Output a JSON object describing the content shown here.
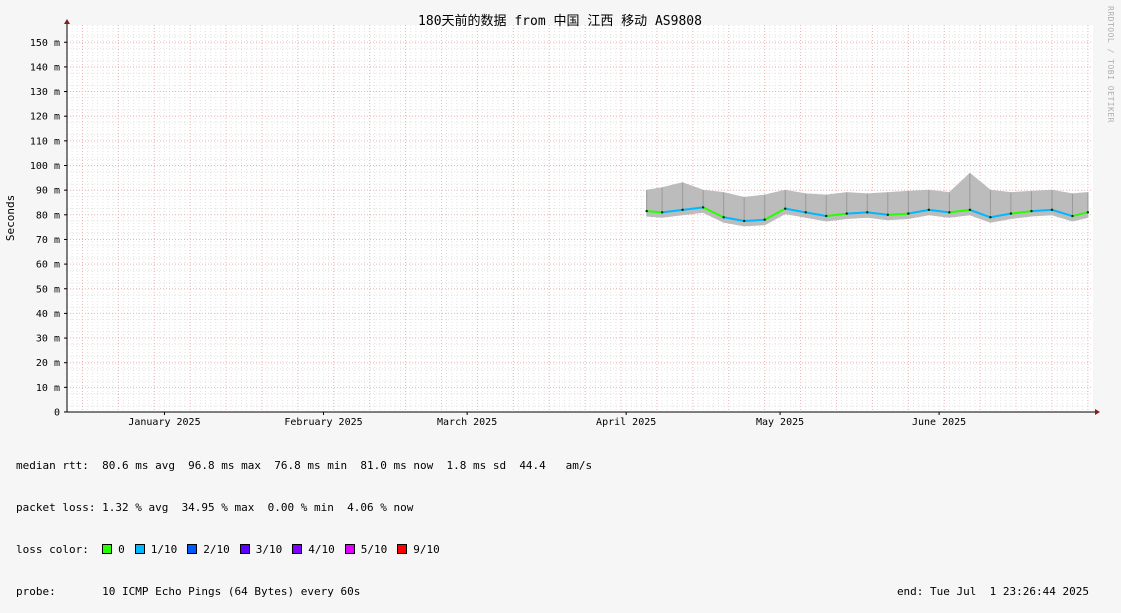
{
  "chart_data": {
    "type": "area",
    "title": "180天前的数据 from 中国 江西 移动 AS9808",
    "ylabel": "Seconds",
    "ylim": [
      0,
      157
    ],
    "y_ticks": [
      {
        "value": 0,
        "label": "0"
      },
      {
        "value": 10,
        "label": "10 m"
      },
      {
        "value": 20,
        "label": "20 m"
      },
      {
        "value": 30,
        "label": "30 m"
      },
      {
        "value": 40,
        "label": "40 m"
      },
      {
        "value": 50,
        "label": "50 m"
      },
      {
        "value": 60,
        "label": "60 m"
      },
      {
        "value": 70,
        "label": "70 m"
      },
      {
        "value": 80,
        "label": "80 m"
      },
      {
        "value": 90,
        "label": "90 m"
      },
      {
        "value": 100,
        "label": "100 m"
      },
      {
        "value": 110,
        "label": "110 m"
      },
      {
        "value": 120,
        "label": "120 m"
      },
      {
        "value": 130,
        "label": "130 m"
      },
      {
        "value": 140,
        "label": "140 m"
      },
      {
        "value": 150,
        "label": "150 m"
      }
    ],
    "xlim": [
      "2024-12-13",
      "2025-07-01"
    ],
    "x_ticks": [
      {
        "date": "2025-01-01",
        "label": "January 2025"
      },
      {
        "date": "2025-02-01",
        "label": "February 2025"
      },
      {
        "date": "2025-03-01",
        "label": "March 2025"
      },
      {
        "date": "2025-04-01",
        "label": "April 2025"
      },
      {
        "date": "2025-05-01",
        "label": "May 2025"
      },
      {
        "date": "2025-06-01",
        "label": "June 2025"
      }
    ],
    "grid": true,
    "series": [
      {
        "name": "median rtt",
        "x": [
          "2025-04-05",
          "2025-04-08",
          "2025-04-12",
          "2025-04-16",
          "2025-04-20",
          "2025-04-24",
          "2025-04-28",
          "2025-05-02",
          "2025-05-06",
          "2025-05-10",
          "2025-05-14",
          "2025-05-18",
          "2025-05-22",
          "2025-05-26",
          "2025-05-30",
          "2025-06-03",
          "2025-06-07",
          "2025-06-11",
          "2025-06-15",
          "2025-06-19",
          "2025-06-23",
          "2025-06-27",
          "2025-06-30"
        ],
        "values": [
          81.5,
          81.0,
          82.0,
          83.0,
          79.0,
          77.5,
          78.0,
          82.5,
          81.0,
          79.5,
          80.5,
          81.0,
          80.0,
          80.5,
          82.0,
          81.0,
          82.0,
          79.0,
          80.5,
          81.5,
          82.0,
          79.5,
          81.0
        ]
      },
      {
        "name": "max rtt",
        "x": [
          "2025-04-05",
          "2025-04-08",
          "2025-04-12",
          "2025-04-16",
          "2025-04-20",
          "2025-04-24",
          "2025-04-28",
          "2025-05-02",
          "2025-05-06",
          "2025-05-10",
          "2025-05-14",
          "2025-05-18",
          "2025-05-22",
          "2025-05-26",
          "2025-05-30",
          "2025-06-03",
          "2025-06-07",
          "2025-06-11",
          "2025-06-15",
          "2025-06-19",
          "2025-06-23",
          "2025-06-27",
          "2025-06-30"
        ],
        "values": [
          90.0,
          91.0,
          93.0,
          90.0,
          89.0,
          87.0,
          88.0,
          90.0,
          88.5,
          88.0,
          89.0,
          88.5,
          89.0,
          89.5,
          90.0,
          89.0,
          96.8,
          90.0,
          89.0,
          89.5,
          90.0,
          88.5,
          89.0
        ]
      }
    ],
    "loss_colors": [
      {
        "label": "0",
        "color": "#26ff00"
      },
      {
        "label": "1/10",
        "color": "#00b8ff"
      },
      {
        "label": "2/10",
        "color": "#0059ff"
      },
      {
        "label": "3/10",
        "color": "#5e00ff"
      },
      {
        "label": "4/10",
        "color": "#7e00ff"
      },
      {
        "label": "5/10",
        "color": "#dd00ff"
      },
      {
        "label": "9/10",
        "color": "#ff0000"
      }
    ],
    "watermark": "RRDTOOL / TOBI OETIKER"
  },
  "stats": {
    "median_rtt": "median rtt:  80.6 ms avg  96.8 ms max  76.8 ms min  81.0 ms now  1.8 ms sd  44.4   am/s",
    "packet_loss": "packet loss: 1.32 % avg  34.95 % max  0.00 % min  4.06 % now",
    "loss_color_label": "loss color:",
    "probe": "probe:       10 ICMP Echo Pings (64 Bytes) every 60s",
    "end": "end: Tue Jul  1 23:26:44 2025"
  },
  "colors": {
    "background": "#f6f6f6",
    "plot_bg": "#ffffff",
    "grid_minor": "#e3e3e3",
    "grid_major": "#ebb5b5",
    "axis": "#000000",
    "arrow": "#8a1c1c",
    "smoke": "#bcbcbc"
  }
}
